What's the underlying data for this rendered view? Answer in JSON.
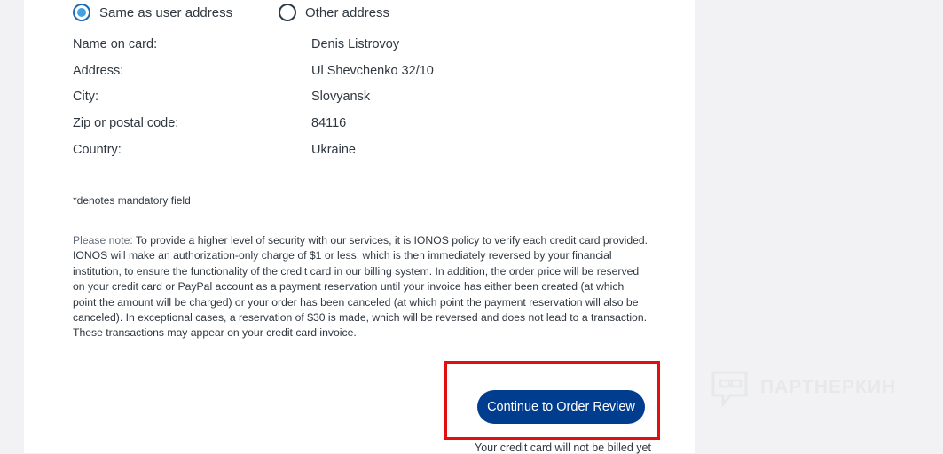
{
  "address_choice": {
    "options": [
      {
        "label": "Same as user address",
        "checked": true
      },
      {
        "label": "Other address",
        "checked": false
      }
    ]
  },
  "card_details": [
    {
      "label": "Name on card:",
      "value": "Denis Listrovoy"
    },
    {
      "label": "Address:",
      "value": "Ul Shevchenko 32/10"
    },
    {
      "label": "City:",
      "value": "Slovyansk"
    },
    {
      "label": "Zip or postal code:",
      "value": "84116"
    },
    {
      "label": "Country:",
      "value": "Ukraine"
    }
  ],
  "mandatory_note": "*denotes mandatory field",
  "please_note": {
    "prefix": "Please note:",
    "text": " To provide a higher level of security with our services, it is IONOS policy to verify each credit card provided. IONOS will make an authorization-only charge of $1 or less, which is then immediately reversed by your financial institution, to ensure the functionality of the credit card in our billing system. In addition, the order price will be reserved on your credit card or PayPal account as a payment reservation until your invoice has either been created (at which point the amount will be charged) or your order has been canceled (at which point the payment reservation will also be canceled). In exceptional cases, a reservation of $30 is made, which will be reversed and does not lead to a transaction. These transactions may appear on your credit card invoice."
  },
  "actions": {
    "continue_label": "Continue to Order Review",
    "billing_note": "Your credit card will not be billed yet"
  },
  "watermark": {
    "text": "ПАРТНЕРКИН",
    "icon": "chat-bubble-logo-icon"
  },
  "colors": {
    "primary_button": "#003d8f",
    "radio_selected": "#46a0e0",
    "highlight_border": "#e01010",
    "background": "#f2f2f4"
  }
}
